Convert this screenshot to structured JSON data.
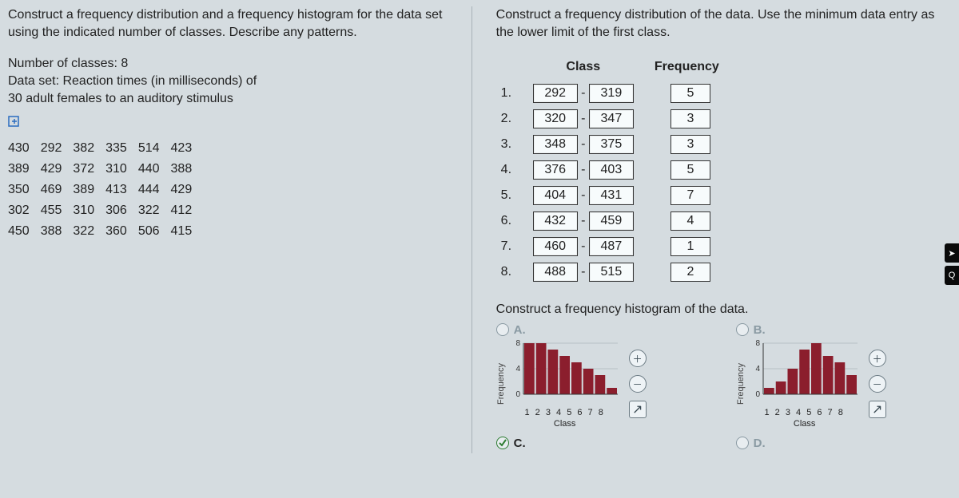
{
  "left": {
    "prompt": "Construct a frequency distribution and a frequency histogram for the data set using the indicated number of classes. Describe any patterns.",
    "numclasses_label": "Number of classes: 8",
    "dataset_label1": "Data set: Reaction times (in milliseconds) of",
    "dataset_label2": "30 adult females to an auditory stimulus",
    "grid": [
      [
        430,
        292,
        382,
        335,
        514,
        423
      ],
      [
        389,
        429,
        372,
        310,
        440,
        388
      ],
      [
        350,
        469,
        389,
        413,
        444,
        429
      ],
      [
        302,
        455,
        310,
        306,
        322,
        412
      ],
      [
        450,
        388,
        322,
        360,
        506,
        415
      ]
    ]
  },
  "right": {
    "prompt": "Construct a frequency distribution of the data. Use the minimum data entry as the lower limit of the first class.",
    "headers": {
      "class": "Class",
      "freq": "Frequency"
    },
    "rows": [
      {
        "n": "1.",
        "lo": "292",
        "hi": "319",
        "f": "5"
      },
      {
        "n": "2.",
        "lo": "320",
        "hi": "347",
        "f": "3"
      },
      {
        "n": "3.",
        "lo": "348",
        "hi": "375",
        "f": "3"
      },
      {
        "n": "4.",
        "lo": "376",
        "hi": "403",
        "f": "5"
      },
      {
        "n": "5.",
        "lo": "404",
        "hi": "431",
        "f": "7"
      },
      {
        "n": "6.",
        "lo": "432",
        "hi": "459",
        "f": "4"
      },
      {
        "n": "7.",
        "lo": "460",
        "hi": "487",
        "f": "1"
      },
      {
        "n": "8.",
        "lo": "488",
        "hi": "515",
        "f": "2"
      }
    ],
    "hist_prompt": "Construct a frequency histogram of the data.",
    "options": {
      "A": {
        "label": "A.",
        "selected": false
      },
      "B": {
        "label": "B.",
        "selected": false
      },
      "C": {
        "label": "C.",
        "selected": true
      },
      "D": {
        "label": "D.",
        "selected": false
      }
    },
    "axis": {
      "y": "Frequency",
      "x": "Class",
      "xticks": "1 2 3 4 5 6 7 8"
    }
  },
  "chart_data": [
    {
      "type": "bar",
      "name": "Option A histogram",
      "categories": [
        1,
        2,
        3,
        4,
        5,
        6,
        7,
        8
      ],
      "values": [
        8,
        8,
        7,
        6,
        5,
        4,
        3,
        1
      ],
      "xlabel": "Class",
      "ylabel": "Frequency",
      "ylim": [
        0,
        8
      ],
      "yticks": [
        0,
        4,
        8
      ]
    },
    {
      "type": "bar",
      "name": "Option B histogram",
      "categories": [
        1,
        2,
        3,
        4,
        5,
        6,
        7,
        8
      ],
      "values": [
        1,
        2,
        4,
        7,
        8,
        6,
        5,
        3
      ],
      "xlabel": "Class",
      "ylabel": "Frequency",
      "ylim": [
        0,
        8
      ],
      "yticks": [
        0,
        4,
        8
      ]
    }
  ]
}
